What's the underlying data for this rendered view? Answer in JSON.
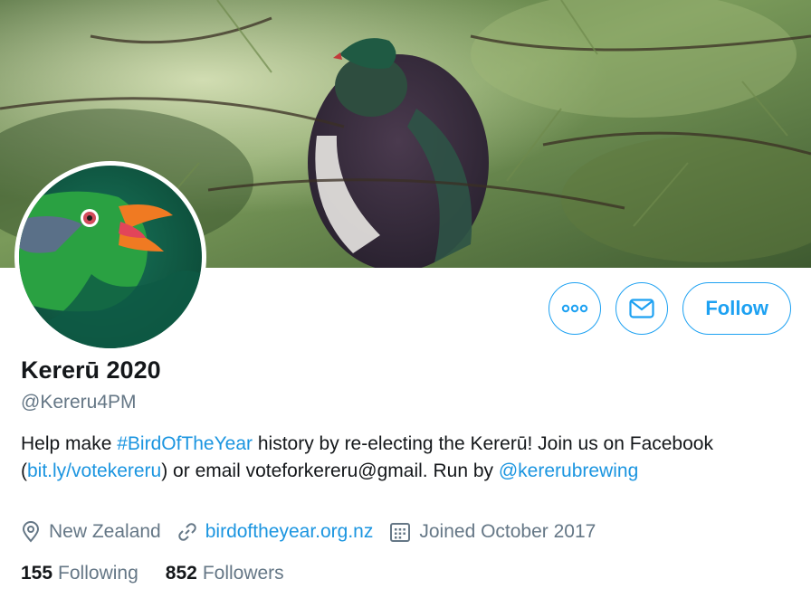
{
  "profile": {
    "display_name": "Kererū 2020",
    "handle": "@Kereru4PM",
    "bio": {
      "part1": "Help make ",
      "hashtag": "#BirdOfTheYear",
      "part2": " history by re-electing the Kererū! Join us on Facebook (",
      "link": "bit.ly/votekereru",
      "part3": ") or email voteforkereru@gmail. Run by ",
      "mention": "@kererubrewing"
    },
    "location": "New Zealand",
    "website": "birdoftheyear.org.nz",
    "joined": "Joined October 2017"
  },
  "stats": {
    "following_count": "155",
    "following_label": "Following",
    "followers_count": "852",
    "followers_label": "Followers"
  },
  "actions": {
    "follow_label": "Follow"
  },
  "icons": {
    "more": "more-icon",
    "message": "envelope-icon",
    "location": "location-pin-icon",
    "website": "link-icon",
    "joined": "calendar-icon"
  },
  "colors": {
    "accent": "#1da1f2",
    "link": "#1b95e0",
    "secondary_text": "#657786",
    "avatar_bg": "#0f5a45"
  }
}
